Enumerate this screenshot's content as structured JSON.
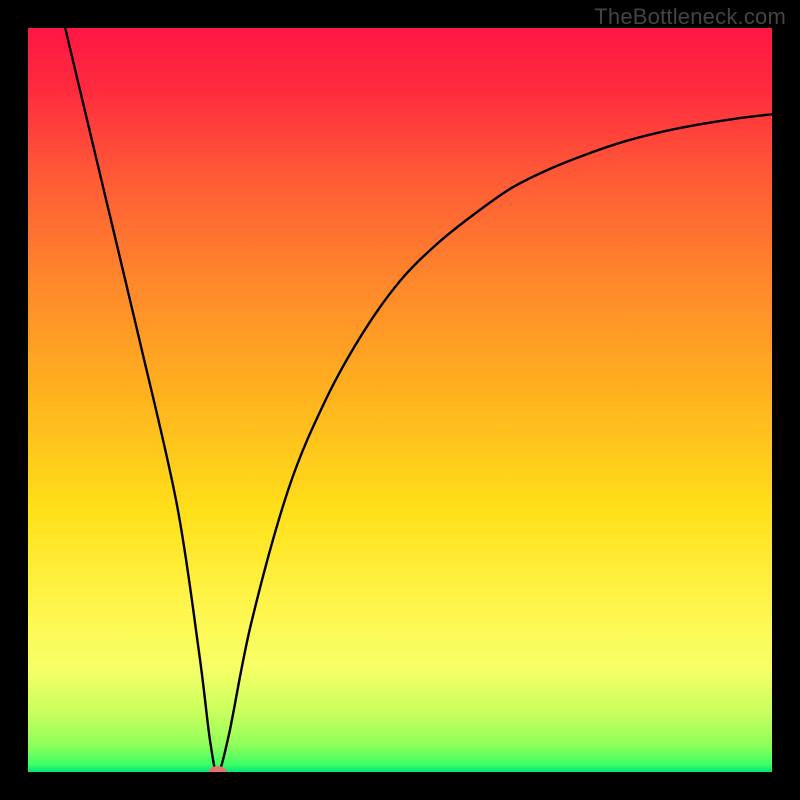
{
  "watermark": "TheBottleneck.com",
  "chart_data": {
    "type": "line",
    "title": "",
    "xlabel": "",
    "ylabel": "",
    "xlim": [
      0,
      100
    ],
    "ylim": [
      0,
      100
    ],
    "gradient_stops": [
      {
        "offset": 0,
        "color": "#ff1744"
      },
      {
        "offset": 0.08,
        "color": "#ff2a3f"
      },
      {
        "offset": 0.2,
        "color": "#ff5a36"
      },
      {
        "offset": 0.35,
        "color": "#ff8a2b"
      },
      {
        "offset": 0.5,
        "color": "#ffb41e"
      },
      {
        "offset": 0.65,
        "color": "#ffe01a"
      },
      {
        "offset": 0.78,
        "color": "#fff64d"
      },
      {
        "offset": 0.86,
        "color": "#f7ff66"
      },
      {
        "offset": 0.92,
        "color": "#c9ff5e"
      },
      {
        "offset": 0.965,
        "color": "#8dff5a"
      },
      {
        "offset": 0.99,
        "color": "#3dff66"
      },
      {
        "offset": 1.0,
        "color": "#00e676"
      }
    ],
    "series": [
      {
        "name": "bottleneck-curve",
        "x": [
          5,
          10,
          15,
          20,
          23,
          24.5,
          25.5,
          27,
          30,
          35,
          40,
          45,
          50,
          55,
          60,
          65,
          70,
          75,
          80,
          85,
          90,
          95,
          100
        ],
        "y": [
          100,
          79,
          58,
          36,
          16,
          4,
          0,
          5,
          20,
          38,
          50,
          59,
          66,
          71,
          75,
          78.5,
          81,
          83,
          84.7,
          86,
          87,
          87.8,
          88.4
        ]
      }
    ],
    "marker": {
      "x": 25.5,
      "y": 0,
      "color": "#e57373"
    }
  }
}
